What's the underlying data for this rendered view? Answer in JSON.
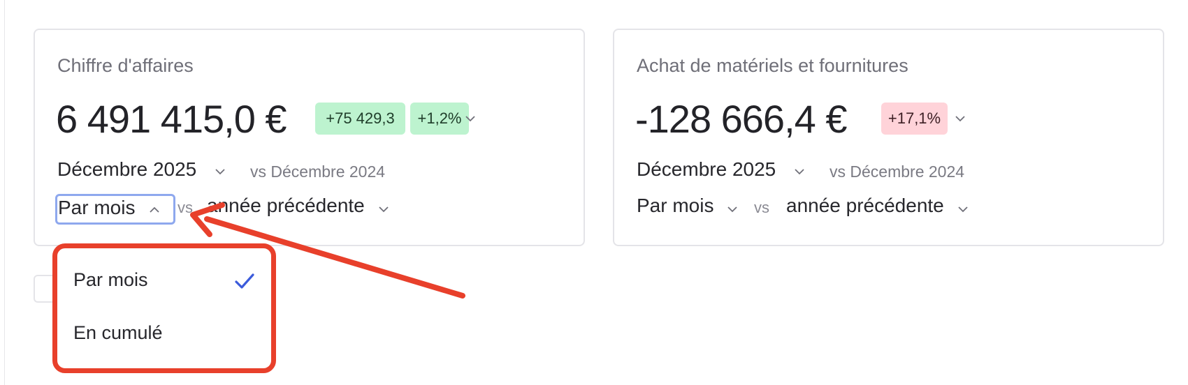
{
  "cards": [
    {
      "title": "Chiffre d'affaires",
      "value": "6 491 415,0 €",
      "badges": [
        "+75 429,3",
        "+1,2%"
      ],
      "period": "Décembre 2025",
      "compare_period": "vs Décembre 2024",
      "mode": "Par mois",
      "vs": "vs",
      "baseline": "année précédente"
    },
    {
      "title": "Achat de matériels et fournitures",
      "value": "-128 666,4 €",
      "badges": [
        "+17,1%"
      ],
      "period": "Décembre 2025",
      "compare_period": "vs Décembre 2024",
      "mode": "Par mois",
      "vs": "vs",
      "baseline": "année précédente"
    }
  ],
  "dropdown": {
    "options": [
      {
        "label": "Par mois",
        "selected": true
      },
      {
        "label": "En cumulé",
        "selected": false
      }
    ]
  },
  "colors": {
    "positive_badge": "#bdf3cf",
    "negative_badge": "#ffd3d9",
    "annotation": "#e8402b",
    "focus": "#8ea8ee",
    "check": "#3b5bdb"
  },
  "icons": [
    "chevron-down-icon",
    "chevron-up-icon",
    "checkmark-icon",
    "annotation-arrow"
  ]
}
